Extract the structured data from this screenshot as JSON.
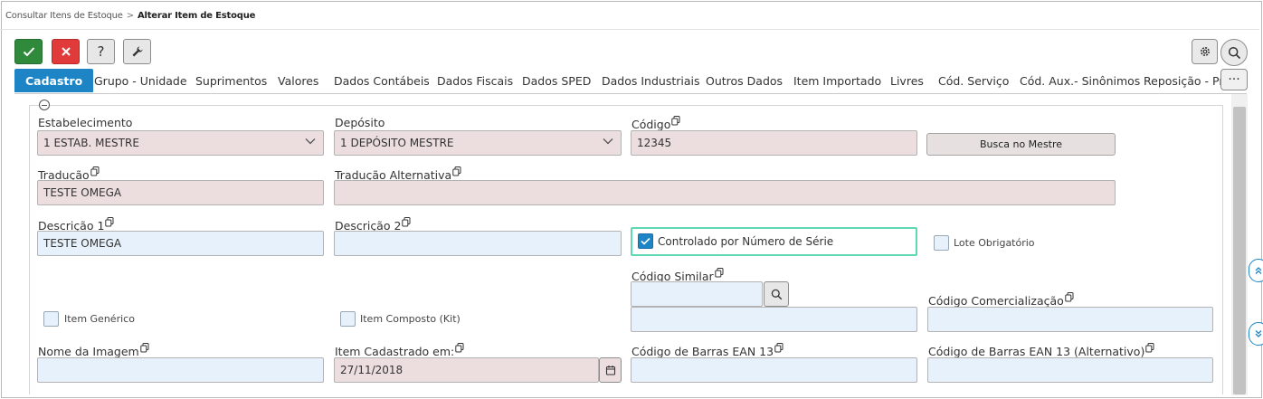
{
  "breadcrumb": {
    "parent": "Consultar Itens de Estoque",
    "separator": ">",
    "current": "Alterar Item de Estoque"
  },
  "toolbar": {
    "ok_icon": "check-icon",
    "cancel_icon": "close-icon",
    "help_label": "?",
    "tools_icon": "wrench-icon",
    "settings_icon": "gear-icon",
    "search_icon": "search-icon",
    "more_label": "···"
  },
  "tabs": [
    {
      "label": "Cadastro",
      "active": true
    },
    {
      "label": "Grupo - Unidade"
    },
    {
      "label": "Suprimentos"
    },
    {
      "label": "Valores"
    },
    {
      "label": "Dados Contábeis"
    },
    {
      "label": "Dados Fiscais"
    },
    {
      "label": "Dados SPED"
    },
    {
      "label": "Dados Industriais"
    },
    {
      "label": "Outros Dados"
    },
    {
      "label": "Item Importado"
    },
    {
      "label": "Livres"
    },
    {
      "label": "Cód. Serviço"
    },
    {
      "label": "Cód. Aux.- Sinônimos"
    },
    {
      "label": "Reposição - Preço"
    }
  ],
  "form": {
    "estabelecimento": {
      "label": "Estabelecimento",
      "value": "1 ESTAB. MESTRE"
    },
    "deposito": {
      "label": "Depósito",
      "value": "1 DEPÓSITO MESTRE"
    },
    "codigo": {
      "label": "Código",
      "value": "12345"
    },
    "busca_mestre": {
      "label": "Busca no Mestre"
    },
    "traducao": {
      "label": "Tradução",
      "value": "TESTE OMEGA"
    },
    "traducao_alt": {
      "label": "Tradução Alternativa",
      "value": ""
    },
    "descricao1": {
      "label": "Descrição 1",
      "value": "TESTE OMEGA"
    },
    "descricao2": {
      "label": "Descrição 2",
      "value": ""
    },
    "controlado_serie": {
      "label": "Controlado por Número de Série",
      "checked": true
    },
    "lote_obrigatorio": {
      "label": "Lote Obrigatório",
      "checked": false
    },
    "codigo_similar": {
      "label": "Código Similar",
      "value": ""
    },
    "codigo_comercializacao": {
      "label": "Código Comercialização",
      "value": ""
    },
    "item_generico": {
      "label": "Item Genérico",
      "checked": false
    },
    "item_composto": {
      "label": "Item Composto (Kit)",
      "checked": false
    },
    "nome_imagem": {
      "label": "Nome da Imagem",
      "value": ""
    },
    "item_cadastrado": {
      "label": "Item Cadastrado em:",
      "value": "27/11/2018"
    },
    "ean13": {
      "label": "Código de Barras EAN 13",
      "value": ""
    },
    "ean13_alt": {
      "label": "Código de Barras EAN 13 (Alternativo)",
      "value": ""
    }
  },
  "colors": {
    "accent": "#1d84c6",
    "ok": "#2f8a3c",
    "cancel": "#e03a3a",
    "readonly_bg": "#ecdede",
    "editable_bg": "#e7f1fb",
    "focus_border": "#5fd7b3"
  }
}
